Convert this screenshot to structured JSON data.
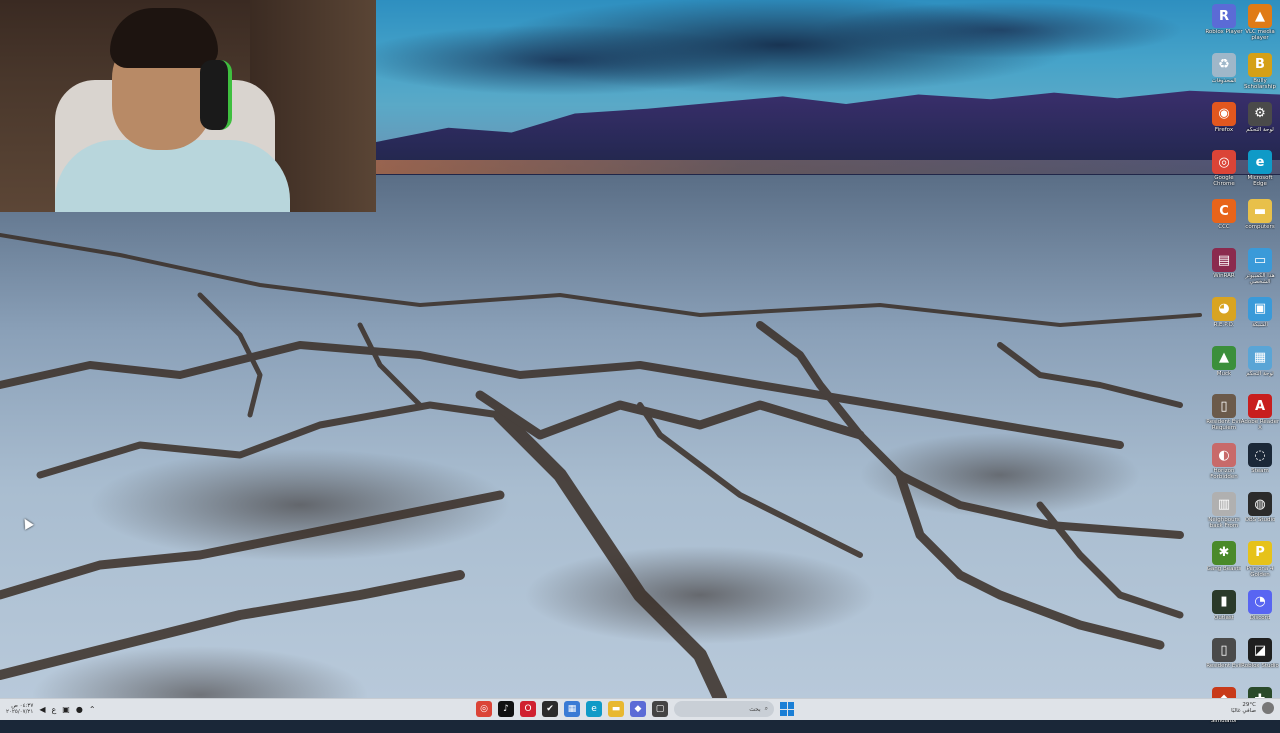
{
  "desktop": {
    "icons": [
      {
        "label": "Roblox Player",
        "icon": "roblox-icon",
        "color": "#5b6bd6",
        "glyph": "R"
      },
      {
        "label": "VLC media player",
        "icon": "vlc-icon",
        "color": "#e07b16",
        "glyph": "▲"
      },
      {
        "label": "المحذوفات",
        "icon": "recycle-bin-icon",
        "color": "#9fb7c9",
        "glyph": "♻"
      },
      {
        "label": "Bully Scholarship",
        "icon": "bully-icon",
        "color": "#d4a017",
        "glyph": "B"
      },
      {
        "label": "Firefox",
        "icon": "firefox-icon",
        "color": "#e2571e",
        "glyph": "◉"
      },
      {
        "label": "لوحة التحكم",
        "icon": "control-panel-icon",
        "color": "#4a4a4a",
        "glyph": "⚙"
      },
      {
        "label": "Google Chrome",
        "icon": "chrome-icon",
        "color": "#db4437",
        "glyph": "◎"
      },
      {
        "label": "Microsoft Edge",
        "icon": "edge-icon",
        "color": "#0f9ac7",
        "glyph": "e"
      },
      {
        "label": "CCC",
        "icon": "ccc-icon",
        "color": "#e8641a",
        "glyph": "C"
      },
      {
        "label": "computers",
        "icon": "folder-icon",
        "color": "#e8c04a",
        "glyph": "▬"
      },
      {
        "label": "WinRAR",
        "icon": "winrar-icon",
        "color": "#8b2a4e",
        "glyph": "▤"
      },
      {
        "label": "هذا الكمبيوتر الشخصي",
        "icon": "this-pc-icon",
        "color": "#3a9ad9",
        "glyph": "▭"
      },
      {
        "label": "R.E.P.O.",
        "icon": "repo-icon",
        "color": "#d9a421",
        "glyph": "◕"
      },
      {
        "label": "الشبكة",
        "icon": "network-icon",
        "color": "#3a9ad9",
        "glyph": "▣"
      },
      {
        "label": "Muck",
        "icon": "muck-icon",
        "color": "#3b8f3b",
        "glyph": "▲"
      },
      {
        "label": "لوحة التحكم",
        "icon": "control-panel-icon",
        "color": "#5aa5d6",
        "glyph": "▦"
      },
      {
        "label": "Resident Evil Requiem",
        "icon": "re-requiem-icon",
        "color": "#6b5a4a",
        "glyph": "▯"
      },
      {
        "label": "Adobe Reader X",
        "icon": "adobe-reader-icon",
        "color": "#c81e1e",
        "glyph": "A"
      },
      {
        "label": "Horizon Forbidden",
        "icon": "horizon-icon",
        "color": "#c86a6a",
        "glyph": "◐"
      },
      {
        "label": "Steam",
        "icon": "steam-icon",
        "color": "#1b2838",
        "glyph": "◌"
      },
      {
        "label": "Neighbours back From",
        "icon": "neighbours-icon",
        "color": "#b0b0b0",
        "glyph": "▥"
      },
      {
        "label": "OBS Studio",
        "icon": "obs-icon",
        "color": "#2b2b2b",
        "glyph": "◍"
      },
      {
        "label": "Gang Beasts",
        "icon": "gang-beasts-icon",
        "color": "#4a8a2a",
        "glyph": "✱"
      },
      {
        "label": "Persona 4 Golden",
        "icon": "persona-icon",
        "color": "#e6c21a",
        "glyph": "P"
      },
      {
        "label": "Outlast",
        "icon": "outlast-icon",
        "color": "#2a3a2a",
        "glyph": "▮"
      },
      {
        "label": "Discord",
        "icon": "discord-icon",
        "color": "#5865f2",
        "glyph": "◔"
      },
      {
        "label": "Resident Evil",
        "icon": "resident-evil-icon",
        "color": "#4a4a4a",
        "glyph": "▯"
      },
      {
        "label": "Roblox Studio",
        "icon": "roblox-studio-icon",
        "color": "#1f1f1f",
        "glyph": "◪"
      },
      {
        "label": "Gas Station Simulator",
        "icon": "gas-station-icon",
        "color": "#c83a1a",
        "glyph": "◆"
      },
      {
        "label": "Outlast",
        "icon": "outlast-icon",
        "color": "#2a4a2a",
        "glyph": "✚"
      }
    ]
  },
  "taskbar": {
    "clock_time": "٠٤:٣٧ ص",
    "clock_date": "٢٠٢٥/٠٧/٢١",
    "search_placeholder": "بحث",
    "weather_temp": "29°C",
    "weather_desc": "صافي غالبًا",
    "pinned": [
      {
        "icon": "chrome-icon",
        "color": "#db4437",
        "glyph": "◎"
      },
      {
        "icon": "tiktok-icon",
        "color": "#111111",
        "glyph": "♪"
      },
      {
        "icon": "opera-icon",
        "color": "#d02030",
        "glyph": "O"
      },
      {
        "icon": "capcut-icon",
        "color": "#2b2b2b",
        "glyph": "✔"
      },
      {
        "icon": "store-icon",
        "color": "#3a7bd5",
        "glyph": "▦"
      },
      {
        "icon": "edge-icon",
        "color": "#0f9ac7",
        "glyph": "e"
      },
      {
        "icon": "file-explorer-icon",
        "color": "#e8b830",
        "glyph": "▬"
      },
      {
        "icon": "roblox-icon",
        "color": "#5b6bd6",
        "glyph": "◆"
      },
      {
        "icon": "task-view-icon",
        "color": "#444444",
        "glyph": "▢"
      }
    ]
  }
}
